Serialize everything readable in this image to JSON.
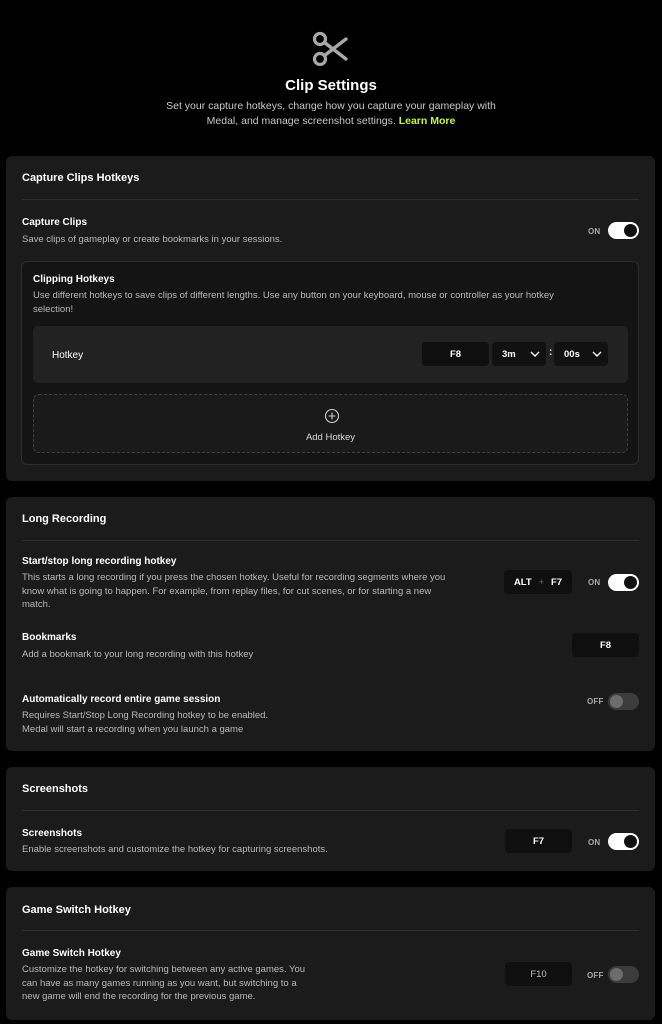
{
  "header": {
    "title": "Clip Settings",
    "subtitle_line1": "Set your capture hotkeys, change how you capture your gameplay with",
    "subtitle_line2": "Medal, and manage screenshot settings.",
    "learn_more": "Learn More",
    "logo_icon": "scissors-icon"
  },
  "capture_clips": {
    "section_title": "Capture Clips Hotkeys",
    "title": "Capture Clips",
    "desc": "Save clips of gameplay or create bookmarks in your sessions.",
    "toggle_label": "ON",
    "toggle_on": true,
    "clipping": {
      "title": "Clipping Hotkeys",
      "desc_line1": "Use different hotkeys to save clips of different lengths. Use any button on your keyboard, mouse or controller as your hotkey",
      "desc_line2": "selection!",
      "hotkey_label": "Hotkey",
      "hotkey_key": "F8",
      "minutes": "3m",
      "colon": ":",
      "seconds": "00s",
      "add_label": "Add Hotkey"
    }
  },
  "long_recording": {
    "section_title": "Long Recording",
    "start_stop": {
      "title": "Start/stop long recording hotkey",
      "desc_line1": "This starts a long recording if you press the chosen hotkey. Useful for recording segments where you",
      "desc_line2": "know what is going to happen. For example, from replay files, for cut scenes, or for starting a new",
      "desc_line3": "match.",
      "key1": "ALT",
      "plus": "+",
      "key2": "F7",
      "toggle_label": "ON",
      "toggle_on": true
    },
    "bookmarks": {
      "title": "Bookmarks",
      "desc": "Add a bookmark to your long recording with this hotkey",
      "key": "F8"
    },
    "auto_record": {
      "title": "Automatically record entire game session",
      "desc_line1": "Requires Start/Stop Long Recording hotkey to be enabled.",
      "desc_line2": "Medal will start a recording when you launch a game",
      "toggle_label": "OFF",
      "toggle_on": false
    }
  },
  "screenshots": {
    "section_title": "Screenshots",
    "title": "Screenshots",
    "desc": "Enable screenshots and customize the hotkey for capturing screenshots.",
    "key": "F7",
    "toggle_label": "ON",
    "toggle_on": true
  },
  "game_switch": {
    "section_title": "Game Switch Hotkey",
    "title": "Game Switch Hotkey",
    "desc_line1": "Customize the hotkey for switching between any active games. You",
    "desc_line2": "can have as many games running as you want, but switching to a",
    "desc_line3": "new game will end the recording for the previous game.",
    "key": "F10",
    "toggle_label": "OFF",
    "toggle_on": false
  },
  "colors": {
    "accent": "#c3f74a",
    "background": "#000000",
    "card": "#1b1b1c"
  }
}
